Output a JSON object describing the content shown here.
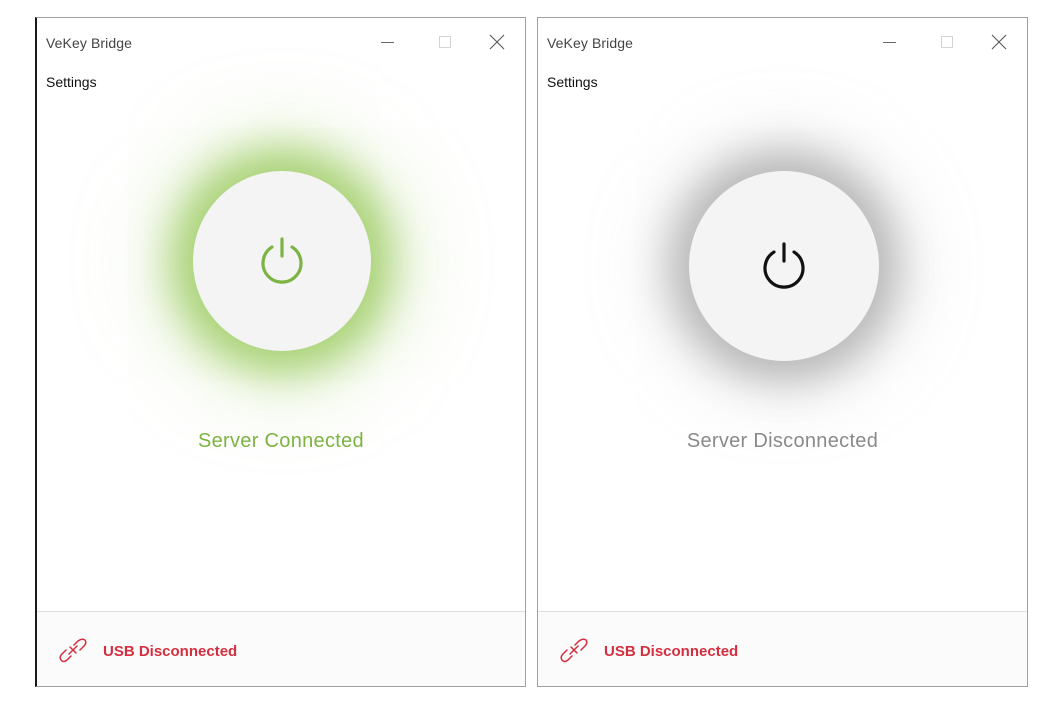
{
  "windows": [
    {
      "title": "VeKey Bridge",
      "menu": {
        "settings_label": "Settings"
      },
      "power": {
        "state": "on",
        "icon": "power-icon",
        "color": "#7cb342",
        "glow_color": "#8bc34a"
      },
      "status": {
        "text": "Server Connected",
        "color": "#7cb342"
      },
      "footer": {
        "usb_icon": "link-broken-icon",
        "usb_text": "USB Disconnected",
        "color": "#d32f3f"
      }
    },
    {
      "title": "VeKey Bridge",
      "menu": {
        "settings_label": "Settings"
      },
      "power": {
        "state": "off",
        "icon": "power-icon",
        "color": "#111111",
        "glow_color": "#888888"
      },
      "status": {
        "text": "Server Disconnected",
        "color": "#8a8a8a"
      },
      "footer": {
        "usb_icon": "link-broken-icon",
        "usb_text": "USB Disconnected",
        "color": "#d32f3f"
      }
    }
  ]
}
